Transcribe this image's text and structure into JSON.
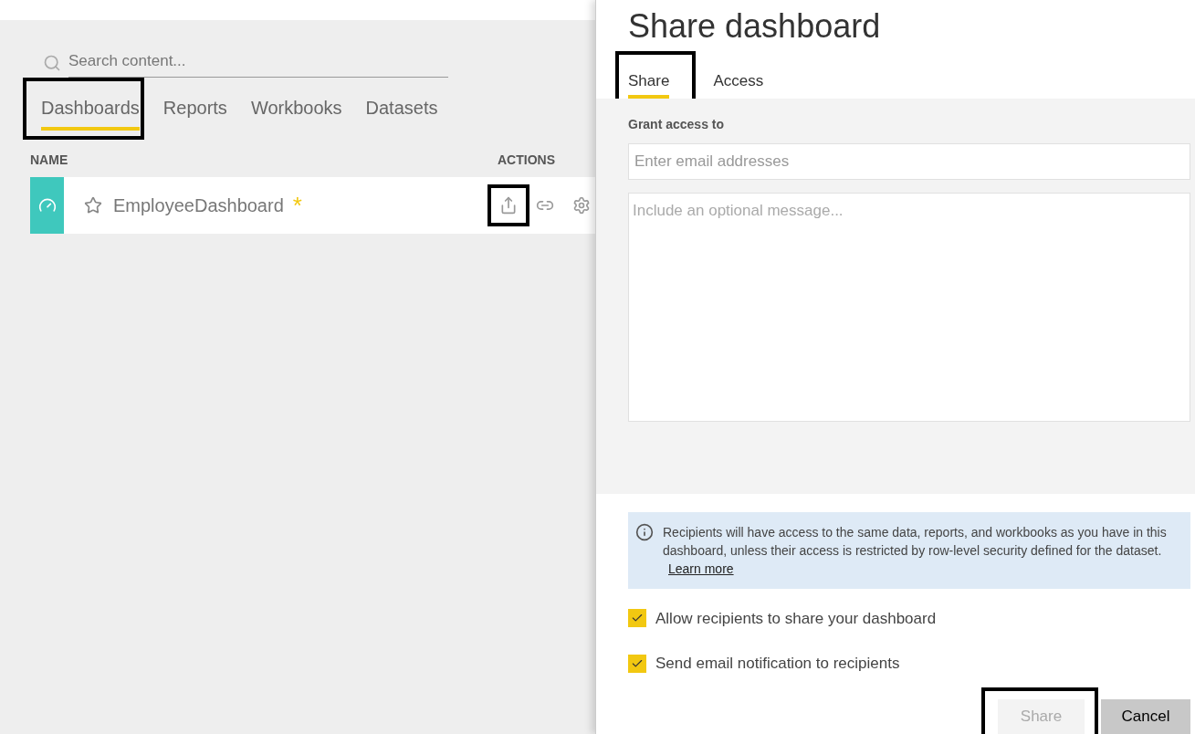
{
  "search": {
    "placeholder": "Search content..."
  },
  "tabs": [
    {
      "label": "Dashboards",
      "selected": true,
      "highlighted": true
    },
    {
      "label": "Reports",
      "selected": false
    },
    {
      "label": "Workbooks",
      "selected": false
    },
    {
      "label": "Datasets",
      "selected": false
    }
  ],
  "table": {
    "columns": [
      "NAME",
      "ACTIONS"
    ],
    "rows": [
      {
        "name": "EmployeeDashboard",
        "favorite": false,
        "new_marker": "*",
        "actions": [
          {
            "kind": "share",
            "highlighted": true
          },
          {
            "kind": "link"
          },
          {
            "kind": "settings"
          }
        ]
      }
    ]
  },
  "dialog": {
    "title": "Share dashboard",
    "tabs": [
      {
        "label": "Share",
        "selected": true,
        "highlighted": true
      },
      {
        "label": "Access",
        "selected": false
      }
    ],
    "grant_label": "Grant access to",
    "email": {
      "placeholder": "Enter email addresses"
    },
    "message": {
      "placeholder": "Include an optional message..."
    },
    "info": {
      "text": "Recipients will have access to the same data, reports, and workbooks as you have in this dashboard, unless their access is restricted by row-level security defined for the dataset.",
      "link": "Learn more"
    },
    "options": [
      {
        "label": "Allow recipients to share your dashboard",
        "checked": true
      },
      {
        "label": "Send email notification to recipients",
        "checked": true
      }
    ],
    "buttons": [
      {
        "label": "Share",
        "kind": "primary",
        "disabled": true,
        "highlighted": true
      },
      {
        "label": "Cancel",
        "kind": "secondary",
        "disabled": false
      }
    ]
  }
}
